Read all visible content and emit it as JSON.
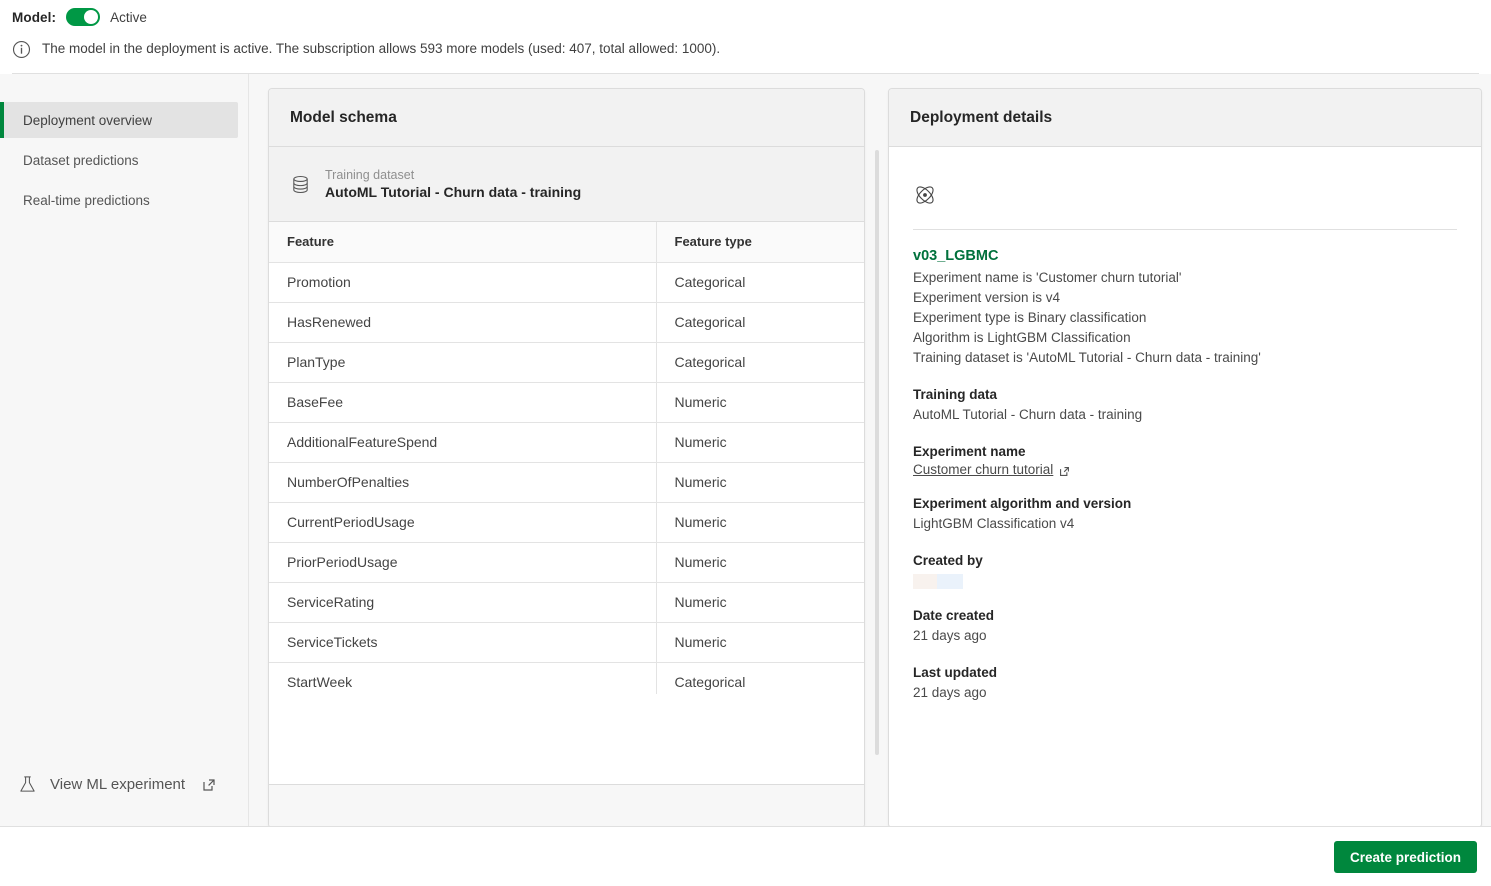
{
  "banner": {
    "model_label": "Model:",
    "toggle_state": "Active",
    "toggle_on": true,
    "info_icon": "info-circle-icon",
    "info_message": "The model in the deployment is active. The subscription allows 593 more models (used: 407, total allowed: 1000).",
    "allows_more_models": 593,
    "used_models": 407,
    "total_allowed_models": 1000
  },
  "sidebar": {
    "items": [
      {
        "label": "Deployment overview",
        "active": true
      },
      {
        "label": "Dataset predictions",
        "active": false
      },
      {
        "label": "Real-time predictions",
        "active": false
      }
    ],
    "experiment_link": {
      "icon": "flask-icon",
      "label": "View ML experiment",
      "external_icon": "external-link-icon"
    }
  },
  "schema_card": {
    "title": "Model schema",
    "dataset": {
      "icon": "database-icon",
      "label": "Training dataset",
      "value": "AutoML Tutorial - Churn data - training"
    },
    "columns": [
      "Feature",
      "Feature type"
    ],
    "rows": [
      {
        "feature": "Promotion",
        "type": "Categorical"
      },
      {
        "feature": "HasRenewed",
        "type": "Categorical"
      },
      {
        "feature": "PlanType",
        "type": "Categorical"
      },
      {
        "feature": "BaseFee",
        "type": "Numeric"
      },
      {
        "feature": "AdditionalFeatureSpend",
        "type": "Numeric"
      },
      {
        "feature": "NumberOfPenalties",
        "type": "Numeric"
      },
      {
        "feature": "CurrentPeriodUsage",
        "type": "Numeric"
      },
      {
        "feature": "PriorPeriodUsage",
        "type": "Numeric"
      },
      {
        "feature": "ServiceRating",
        "type": "Numeric"
      },
      {
        "feature": "ServiceTickets",
        "type": "Numeric"
      },
      {
        "feature": "StartWeek",
        "type": "Categorical"
      }
    ]
  },
  "details_card": {
    "title": "Deployment details",
    "model_icon": "atom-model-icon",
    "model_name": "v03_LGBMC",
    "summary_lines": [
      "Experiment name is 'Customer churn tutorial'",
      "Experiment version is v4",
      "Experiment type is Binary classification",
      "Algorithm is LightGBM Classification",
      "Training dataset is 'AutoML Tutorial - Churn data - training'"
    ],
    "fields": [
      {
        "key": "Training data",
        "value": "AutoML Tutorial - Churn data - training",
        "kind": "text"
      },
      {
        "key": "Experiment name",
        "value": "Customer churn tutorial",
        "kind": "link"
      },
      {
        "key": "Experiment algorithm and version",
        "value": "LightGBM Classification v4",
        "kind": "text"
      },
      {
        "key": "Created by",
        "value": "",
        "kind": "redacted"
      },
      {
        "key": "Date created",
        "value": "21 days ago",
        "kind": "text"
      },
      {
        "key": "Last updated",
        "value": "21 days ago",
        "kind": "text"
      }
    ]
  },
  "footer": {
    "create_button": "Create prediction"
  },
  "colors": {
    "accent_green": "#00873d",
    "model_name_green": "#00713c",
    "toggle_green": "#009845",
    "panel_bg": "#f7f7f7",
    "card_head_bg": "#f2f2f2",
    "border": "#dcdcdc",
    "redaction_warm": "#f8f2ee",
    "redaction_blue": "#eaf2fb"
  }
}
